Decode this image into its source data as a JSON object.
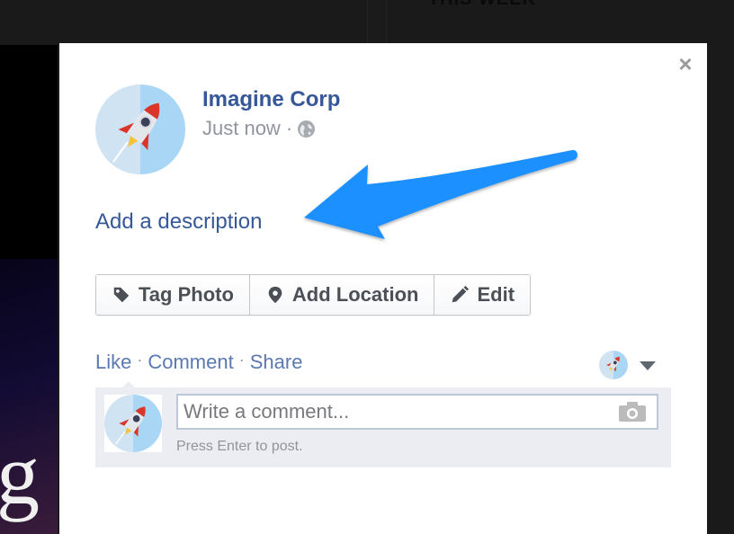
{
  "background": {
    "section_title": "THIS WEEK",
    "logo_fragment": "g"
  },
  "modal": {
    "close_label": "×",
    "post": {
      "page_name": "Imagine Corp",
      "timestamp": "Just now",
      "separator": "·",
      "privacy_icon": "globe-icon",
      "description_link": "Add a description"
    },
    "buttons": [
      {
        "label": "Tag Photo",
        "icon": "tag-icon"
      },
      {
        "label": "Add Location",
        "icon": "location-pin-icon"
      },
      {
        "label": "Edit",
        "icon": "pencil-icon"
      }
    ],
    "actions": {
      "like": "Like",
      "comment": "Comment",
      "share": "Share",
      "separator": "·"
    },
    "comment": {
      "placeholder": "Write a comment...",
      "value": "",
      "hint": "Press Enter to post.",
      "camera_icon": "camera-icon"
    }
  },
  "annotation": {
    "type": "arrow",
    "color": "#1a90ff",
    "points_to": "Add a description"
  },
  "colors": {
    "link": "#365899",
    "action_link": "#5b78b1",
    "muted": "#90949c",
    "button_text": "#4b4f56",
    "comment_bg": "#ecedf3",
    "avatar_light": "#cfe3f3",
    "avatar_dark": "#a9d6f5"
  }
}
